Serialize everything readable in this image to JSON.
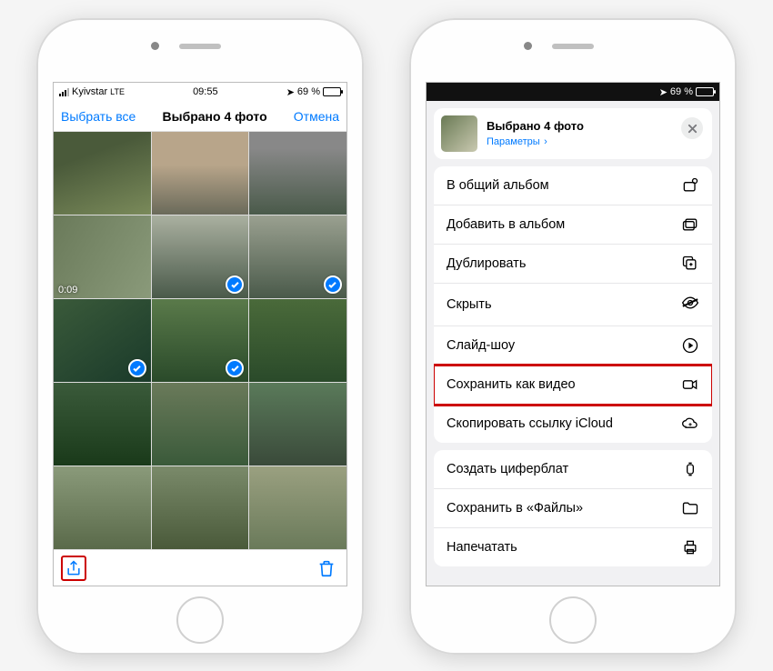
{
  "left": {
    "status": {
      "carrier": "Kyivstar",
      "signal": "lte",
      "time": "09:55",
      "battery": "69 %"
    },
    "nav": {
      "select_all": "Выбрать все",
      "title": "Выбрано 4 фото",
      "cancel": "Отмена"
    },
    "video_duration": "0:09",
    "toolbar": {
      "share": "share",
      "trash": "trash"
    }
  },
  "right": {
    "status": {
      "battery": "69 %"
    },
    "sheet": {
      "title": "Выбрано 4 фото",
      "options": "Параметры",
      "chevron": "›"
    },
    "groups": [
      [
        {
          "label": "В общий альбом",
          "icon": "shared-album"
        },
        {
          "label": "Добавить в альбом",
          "icon": "add-album"
        },
        {
          "label": "Дублировать",
          "icon": "duplicate"
        },
        {
          "label": "Скрыть",
          "icon": "hide"
        },
        {
          "label": "Слайд-шоу",
          "icon": "play"
        },
        {
          "label": "Сохранить как видео",
          "icon": "video",
          "highlight": true
        },
        {
          "label": "Скопировать ссылку iCloud",
          "icon": "icloud-link"
        }
      ],
      [
        {
          "label": "Создать циферблат",
          "icon": "watch"
        },
        {
          "label": "Сохранить в «Файлы»",
          "icon": "folder"
        },
        {
          "label": "Напечатать",
          "icon": "printer"
        }
      ]
    ]
  }
}
